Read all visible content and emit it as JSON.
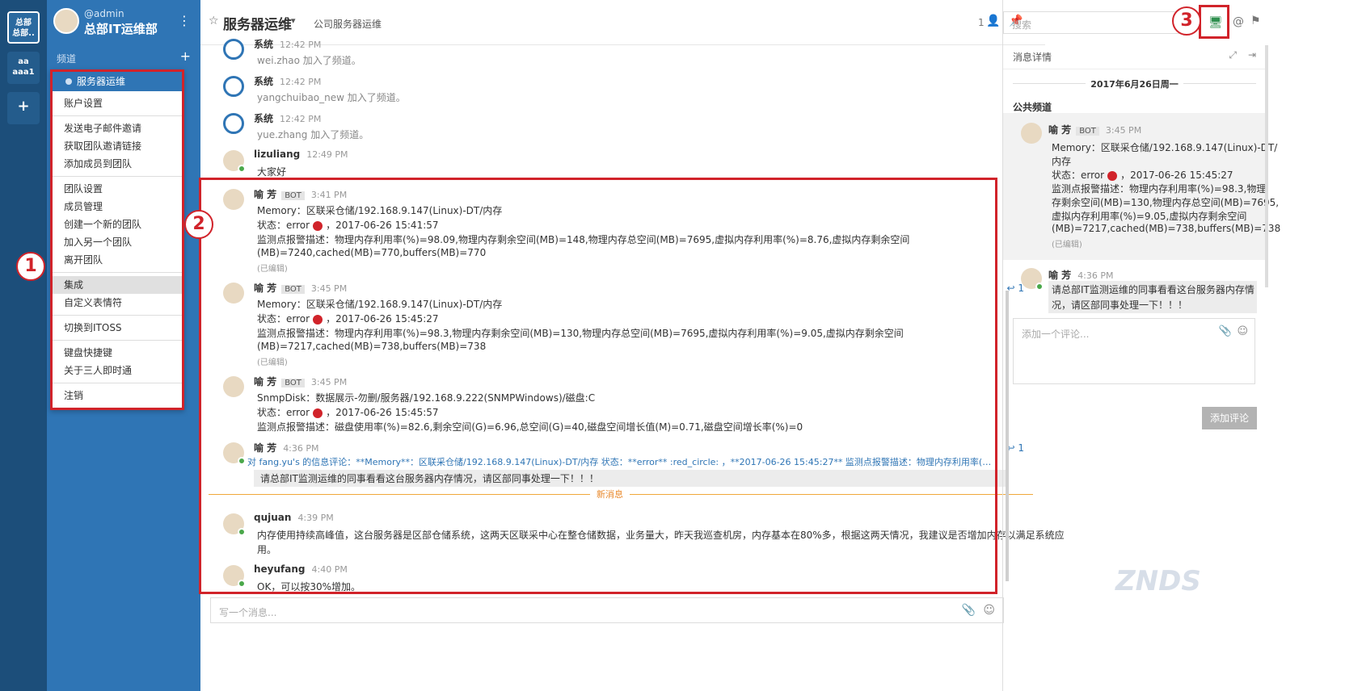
{
  "team_rail": {
    "team1": "总部\n总部..",
    "team2": "aa\naaa1",
    "add": "+"
  },
  "sidebar": {
    "username": "@admin",
    "team_name": "总部IT运维部",
    "channels_label": "频道",
    "dropdown": {
      "active_channel": "服务器运维",
      "groups": [
        [
          "账户设置"
        ],
        [
          "发送电子邮件邀请",
          "获取团队邀请链接",
          "添加成员到团队"
        ],
        [
          "团队设置",
          "成员管理",
          "创建一个新的团队",
          "加入另一个团队",
          "离开团队"
        ],
        [
          "集成",
          "自定义表情符"
        ],
        [
          "切换到ITOSS"
        ],
        [
          "键盘快捷键",
          "关于三人即时通"
        ],
        [
          "注销"
        ]
      ]
    }
  },
  "header": {
    "title": "服务器运维",
    "purpose": "公司服务器运维",
    "member_count": "1"
  },
  "posts": [
    {
      "name": "系统",
      "time": "12:42 PM",
      "lines": [
        "wei.zhao 加入了频道。"
      ],
      "system": true
    },
    {
      "name": "系统",
      "time": "12:42 PM",
      "lines": [
        "yangchuibao_new 加入了频道。"
      ],
      "system": true
    },
    {
      "name": "系统",
      "time": "12:42 PM",
      "lines": [
        "yue.zhang 加入了频道。"
      ],
      "system": true
    },
    {
      "name": "lizuliang",
      "time": "12:49 PM",
      "lines": [
        "大家好"
      ]
    },
    {
      "name": "喻 芳",
      "bot": "BOT",
      "time": "3:41 PM",
      "l1": "Memory：区联采仓储/192.168.9.147(Linux)-DT/内存",
      "status_prefix": "状态：error",
      "status_suffix": "，2017-06-26 15:41:57",
      "l3": "监测点报警描述：物理内存利用率(%)=98.09,物理内存剩余空间(MB)=148,物理内存总空间(MB)=7695,虚拟内存利用率(%)=8.76,虚拟内存剩余空间",
      "l4": "(MB)=7240,cached(MB)=770,buffers(MB)=770",
      "edited": "(已编辑)"
    },
    {
      "name": "喻 芳",
      "bot": "BOT",
      "time": "3:45 PM",
      "replies": "1",
      "l1": "Memory：区联采仓储/192.168.9.147(Linux)-DT/内存",
      "status_prefix": "状态：error",
      "status_suffix": "，2017-06-26 15:45:27",
      "l3": "监测点报警描述：物理内存利用率(%)=98.3,物理内存剩余空间(MB)=130,物理内存总空间(MB)=7695,虚拟内存利用率(%)=9.05,虚拟内存剩余空间",
      "l4": "(MB)=7217,cached(MB)=738,buffers(MB)=738",
      "edited": "(已编辑)"
    },
    {
      "name": "喻 芳",
      "bot": "BOT",
      "time": "3:45 PM",
      "l1": "SnmpDisk：数据展示-勿删/服务器/192.168.9.222(SNMPWindows)/磁盘:C",
      "status_prefix": "状态：error",
      "status_suffix": "，2017-06-26 15:45:57",
      "l3": "监测点报警描述：磁盘使用率(%)=82.6,剩余空间(G)=6.96,总空间(G)=40,磁盘空间增长值(M)=0.71,磁盘空间增长率(%)=0"
    },
    {
      "name": "喻 芳",
      "time": "4:36 PM",
      "replies": "1",
      "comment_on": "对 fang.yu's 的信息评论：**Memory**：区联采仓储/192.168.9.147(Linux)-DT/内存 状态：**error** :red_circle: ，**2017-06-26 15:45:27** 监测点报警描述：物理内存利用率(%)=**98.3**,...",
      "quote": "请总部IT监测运维的同事看看这台服务器内存情况，请区部同事处理一下！！！"
    },
    {
      "name": "qujuan",
      "time": "4:39 PM",
      "l1": "内存使用持续高峰值，这台服务器是区部仓储系统，这两天区联采中心在整仓储数据，业务量大，昨天我巡查机房，内存基本在80%多，根据这两天情况，我建议是否增加内存以满足系统应",
      "l2": "用。"
    },
    {
      "name": "heyufang",
      "time": "4:40 PM",
      "l1": "OK，可以按30%增加。"
    }
  ],
  "new_messages_label": "新消息",
  "message_placeholder": "写一个消息...",
  "search_placeholder": "搜索",
  "right_panel": {
    "title": "消息详情",
    "date": "2017年6月26日周一",
    "channel_label": "公共频道",
    "root": {
      "name": "喻 芳",
      "bot": "BOT",
      "time": "3:45 PM",
      "lines": [
        "Memory：区联采仓储/192.168.9.147(Linux)-DT/",
        "内存",
        "状态：error",
        "，2017-06-26 15:45:27",
        "监测点报警描述：物理内存利用率(%)=98.3,物理",
        "存剩余空间(MB)=130,物理内存总空间(MB)=7695,",
        "虚拟内存利用率(%)=9.05,虚拟内存剩余空间",
        "(MB)=7217,cached(MB)=738,buffers(MB)=738",
        "(已编辑)"
      ]
    },
    "reply": {
      "name": "喻 芳",
      "time": "4:36 PM",
      "lines": [
        "请总部IT监测运维的同事看看这台服务器内存情",
        "况，请区部同事处理一下！！！"
      ]
    },
    "comment_placeholder": "添加一个评论...",
    "add_comment": "添加评论"
  },
  "annotations": [
    "1",
    "2",
    "3"
  ],
  "watermark": "ZNDS"
}
